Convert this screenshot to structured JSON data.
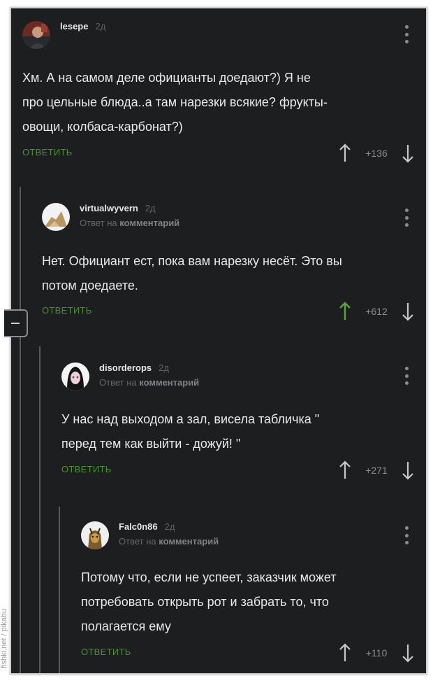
{
  "comments": [
    {
      "user": "lesepe",
      "time": "2д",
      "text": "Хм. А на самом деле официанты доедают?) Я не\nпро цельные блюда..а там нарезки всякие? фрукты-\nовощи, колбаса-карбонат?)",
      "reply_label": "ОТВЕТИТЬ",
      "rating": "+136"
    },
    {
      "user": "virtualwyvern",
      "time": "2д",
      "sub_prefix": "Ответ на",
      "sub_link": "комментарий",
      "text": "Нет. Официант ест, пока вам нарезку несёт. Это вы\nпотом доедаете.",
      "reply_label": "ОТВЕТИТЬ",
      "rating": "+612",
      "upvoted": true
    },
    {
      "user": "disorderops",
      "time": "2д",
      "sub_prefix": "Ответ на",
      "sub_link": "комментарий",
      "text": "У нас над выходом а зал, висела табличка \"\nперед тем как выйти - дожуй! \"",
      "reply_label": "ОТВЕТИТЬ",
      "rating": "+271"
    },
    {
      "user": "Falc0n86",
      "time": "2д",
      "sub_prefix": "Ответ на",
      "sub_link": "комментарий",
      "text": "Потому что, если не успеет, заказчик может\nпотребовать открыть рот и забрать то, что\nполагается ему",
      "reply_label": "ОТВЕТИТЬ",
      "rating": "+110"
    }
  ],
  "icons": {
    "upvote": "arrow-up-icon",
    "downvote": "arrow-down-icon",
    "menu": "kebab-menu-icon",
    "collapse": "minus-icon"
  },
  "colors": {
    "background": "#1d1e20",
    "reply": "#4c8f33",
    "upvoted": "#5ea33a",
    "text": "#e9e9e9",
    "muted": "#8b8d90"
  },
  "watermark": "fishki.net / pikabu"
}
